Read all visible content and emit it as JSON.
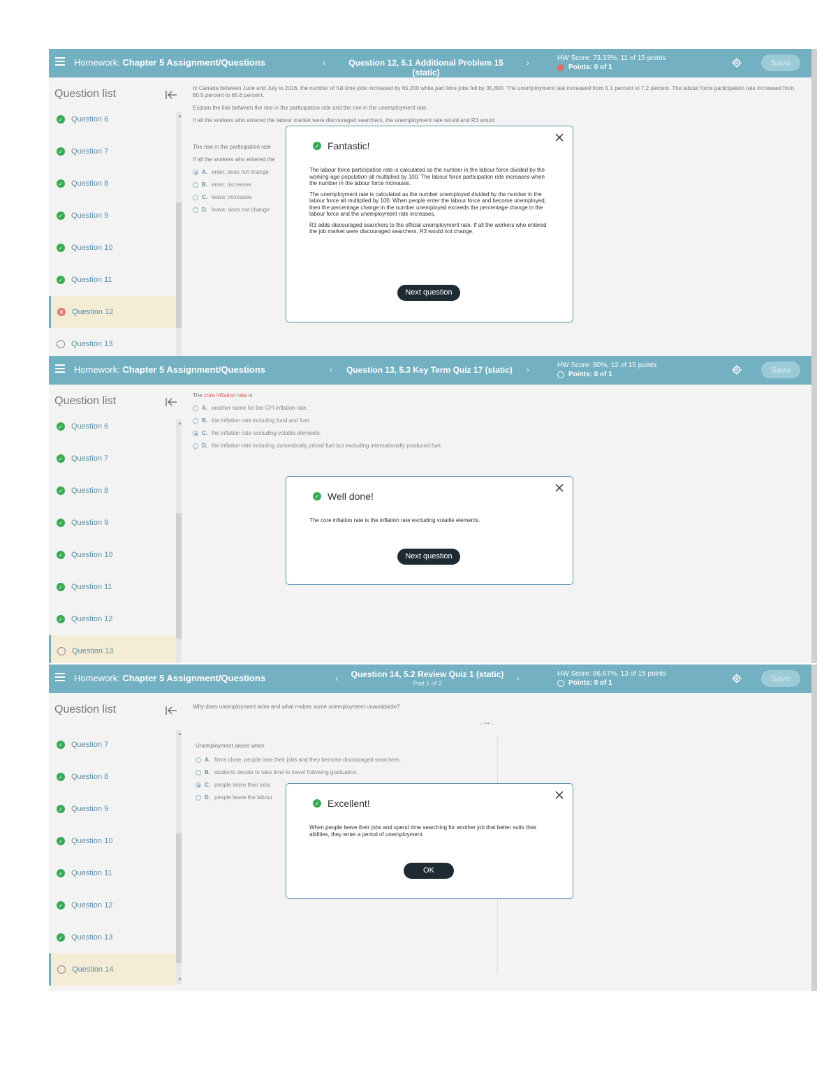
{
  "screens": [
    {
      "header": {
        "hw_prefix": "Homework:",
        "hw_title": "Chapter 5 Assignment/Questions",
        "question_title": "Question 12, 5.1 Additional Problem 15 (static)",
        "hw_score": "HW Score: 73.33%, 11 of 15 points",
        "points": "Points: 0 of 1",
        "save_label": "Save"
      },
      "sidebar": {
        "heading": "Question list",
        "items": [
          {
            "label": "Question 6",
            "status": "correct"
          },
          {
            "label": "Question 7",
            "status": "correct"
          },
          {
            "label": "Question 8",
            "status": "correct"
          },
          {
            "label": "Question 9",
            "status": "correct"
          },
          {
            "label": "Question 10",
            "status": "correct"
          },
          {
            "label": "Question 11",
            "status": "correct"
          },
          {
            "label": "Question 12",
            "status": "wrong"
          },
          {
            "label": "Question 13",
            "status": "open"
          }
        ]
      },
      "content": {
        "intro": "In Canada between June and July in 2016, the number of full time jobs increased by 65,200 while part time jobs fell by 35,800. The unemployment rate increased from 5.1 percent to 7.2 percent. The labour force participation rate increased from 60.5 percent to 65.6 percent.",
        "prompt": "Explain the link between the rise in the participation rate and the rise in the unemployment rate.",
        "question": "If all the workers who entered the labour market were discouraged searchers, the unemployment rate would and R3 would",
        "rise_line": "The rise in the participation rate",
        "if_line": "If all the workers who entered the",
        "choices": [
          {
            "letter": "A.",
            "text": "enter; does not change",
            "selected": true
          },
          {
            "letter": "B.",
            "text": "enter; increases",
            "selected": false
          },
          {
            "letter": "C.",
            "text": "leave; increases",
            "selected": false
          },
          {
            "letter": "D.",
            "text": "leave; does not change",
            "selected": false
          }
        ]
      },
      "dialog": {
        "title": "Fantastic!",
        "paragraphs": [
          "The labour force participation rate is calculated as the number in the labour force divided by the working-age population all multiplied by 100. The labour force participation rate increases when the number in the labour force increases.",
          "The unemployment rate is calculated as the number unemployed divided by the number in the labour force all multiplied by 100. When people enter the labour force and become unemployed, then the percentage change in the number unemployed exceeds the percentage change in the labour force and the unemployment rate increases.",
          "R3 adds discouraged searchers to the official unemployment rate. If all the workers who entered the job market were discouraged searchers, R3 would not change."
        ],
        "button": "Next question"
      }
    },
    {
      "header": {
        "hw_prefix": "Homework:",
        "hw_title": "Chapter 5 Assignment/Questions",
        "question_title": "Question 13, 5.3 Key Term Quiz 17 (static)",
        "hw_score": "HW Score: 80%, 12 of 15 points",
        "points": "Points: 0 of 1",
        "save_label": "Save"
      },
      "sidebar": {
        "heading": "Question list",
        "items": [
          {
            "label": "Question 6",
            "status": "correct"
          },
          {
            "label": "Question 7",
            "status": "correct"
          },
          {
            "label": "Question 8",
            "status": "correct"
          },
          {
            "label": "Question 9",
            "status": "correct"
          },
          {
            "label": "Question 10",
            "status": "correct"
          },
          {
            "label": "Question 11",
            "status": "correct"
          },
          {
            "label": "Question 12",
            "status": "correct"
          },
          {
            "label": "Question 13",
            "status": "open"
          }
        ]
      },
      "content": {
        "intro_prefix": "The",
        "intro_term": "core inflation rate",
        "intro_suffix": "is",
        "choices": [
          {
            "letter": "A.",
            "text": "another name for the CPI inflation rate.",
            "selected": false
          },
          {
            "letter": "B.",
            "text": "the inflation rate including food and fuel.",
            "selected": false
          },
          {
            "letter": "C.",
            "text": "the inflation rate excluding volatile elements.",
            "selected": true
          },
          {
            "letter": "D.",
            "text": "the inflation rate including domestically priced fuel but excluding internationally produced fuel.",
            "selected": false
          }
        ]
      },
      "dialog": {
        "title": "Well done!",
        "paragraphs": [
          "The core inflation rate is the inflation rate excluding volatile elements."
        ],
        "button": "Next question"
      }
    },
    {
      "header": {
        "hw_prefix": "Homework:",
        "hw_title": "Chapter 5 Assignment/Questions",
        "question_title": "Question 14, 5.2 Review Quiz 1 (static)",
        "question_part": "Part 1 of 2",
        "hw_score": "HW Score: 86.67%, 13 of 15 points",
        "points": "Points: 0 of 1",
        "save_label": "Save"
      },
      "sidebar": {
        "heading": "Question list",
        "items": [
          {
            "label": "Question 7",
            "status": "correct"
          },
          {
            "label": "Question 8",
            "status": "correct"
          },
          {
            "label": "Question 9",
            "status": "correct"
          },
          {
            "label": "Question 10",
            "status": "correct"
          },
          {
            "label": "Question 11",
            "status": "correct"
          },
          {
            "label": "Question 12",
            "status": "correct"
          },
          {
            "label": "Question 13",
            "status": "correct"
          },
          {
            "label": "Question 14",
            "status": "open"
          }
        ]
      },
      "content": {
        "intro": "Why does unemployment arise and what makes some unemployment unavoidable?",
        "pager": "‹ ••• ›",
        "lead": "Unemployment arises when",
        "choices": [
          {
            "letter": "A.",
            "text": "firms close, people lose their jobs and they become discouraged searchers.",
            "selected": false
          },
          {
            "letter": "B.",
            "text": "students decide to take time to travel following graduation.",
            "selected": false
          },
          {
            "letter": "C.",
            "text": "people leave their jobs",
            "selected": true
          },
          {
            "letter": "D.",
            "text": "people leave the labour",
            "selected": false
          }
        ]
      },
      "dialog": {
        "title": "Excellent!",
        "paragraphs": [
          "When people leave their jobs and spend time searching for another job that better suits their abilities, they enter a period of unemployment."
        ],
        "button": "OK"
      }
    }
  ],
  "colors": {
    "header_bg": "#73b0c2",
    "correct": "#3aaa52",
    "wrong": "#e07d7d",
    "active_item_bg": "#f4ecd5",
    "dialog_border": "#5d95ad",
    "button_dark": "#1e2b33"
  },
  "icons": [
    "menu-icon",
    "gear-icon",
    "collapse-sidebar-icon",
    "check-circle-icon",
    "x-circle-icon",
    "empty-circle-icon",
    "close-icon"
  ]
}
